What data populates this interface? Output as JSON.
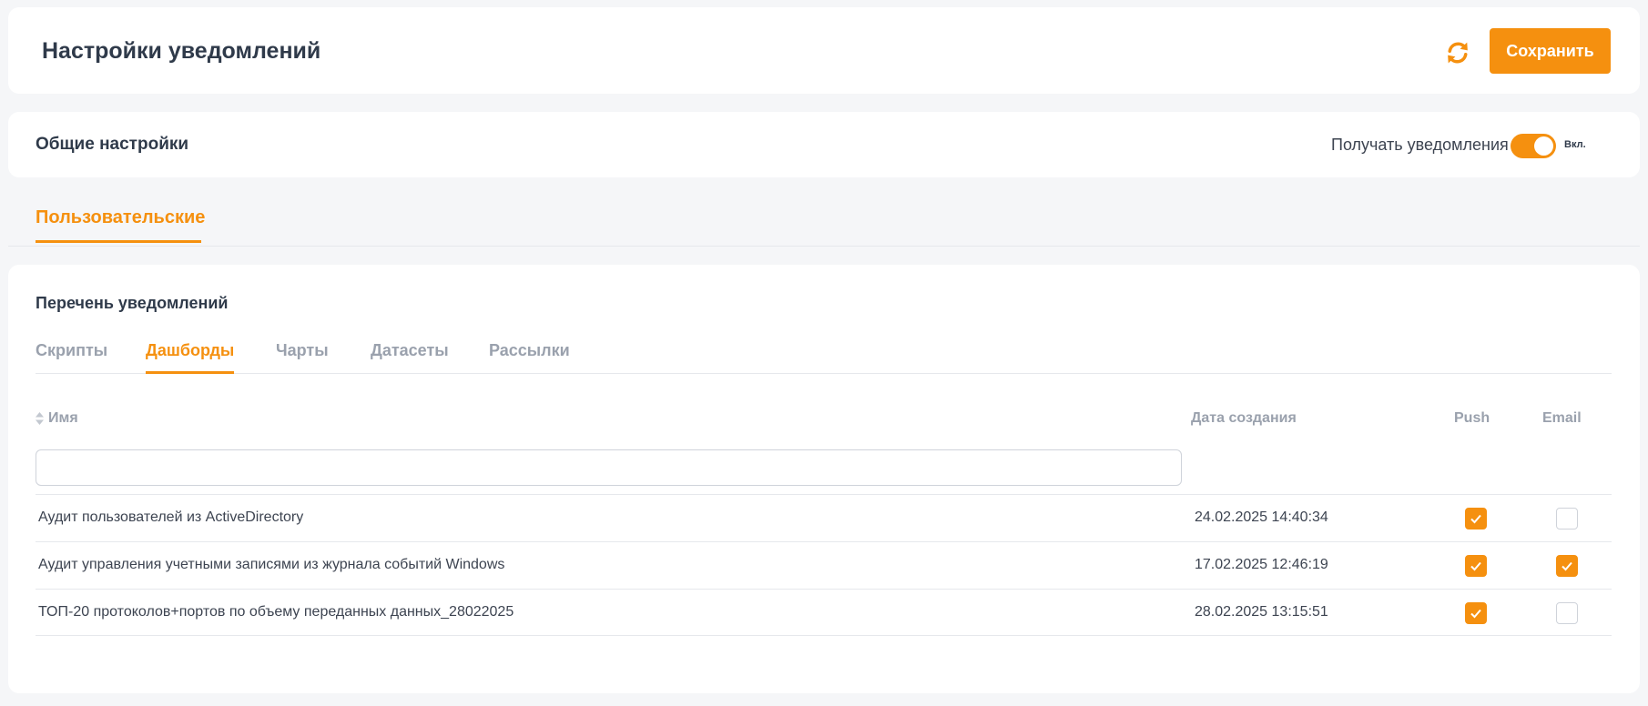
{
  "header": {
    "title": "Настройки уведомлений",
    "refresh_icon": "refresh-icon",
    "save_label": "Сохранить"
  },
  "general": {
    "title": "Общие настройки",
    "receive_label": "Получать уведомления",
    "toggle_state": "Вкл.",
    "toggle_on": true
  },
  "top_tab": {
    "label": "Пользовательские"
  },
  "list": {
    "title": "Перечень уведомлений",
    "tabs": [
      {
        "label": "Скрипты",
        "active": false
      },
      {
        "label": "Дашборды",
        "active": true
      },
      {
        "label": "Чарты",
        "active": false
      },
      {
        "label": "Датасеты",
        "active": false
      },
      {
        "label": "Рассылки",
        "active": false
      }
    ],
    "columns": {
      "name": "Имя",
      "date": "Дата создания",
      "push": "Push",
      "email": "Email"
    },
    "search": {
      "value": "",
      "placeholder": ""
    },
    "rows": [
      {
        "name": "Аудит пользователей из ActiveDirectory",
        "date": "24.02.2025 14:40:34",
        "push": true,
        "email": false
      },
      {
        "name": "Аудит управления учетными записями из журнала событий Windows",
        "date": "17.02.2025 12:46:19",
        "push": true,
        "email": true
      },
      {
        "name": "ТОП-20 протоколов+портов по объему переданных данных_28022025",
        "date": "28.02.2025 13:15:51",
        "push": true,
        "email": false
      }
    ]
  },
  "colors": {
    "accent": "#f5900f",
    "text": "#3d4451",
    "muted": "#9aa1ad",
    "background": "#f5f6f8"
  }
}
